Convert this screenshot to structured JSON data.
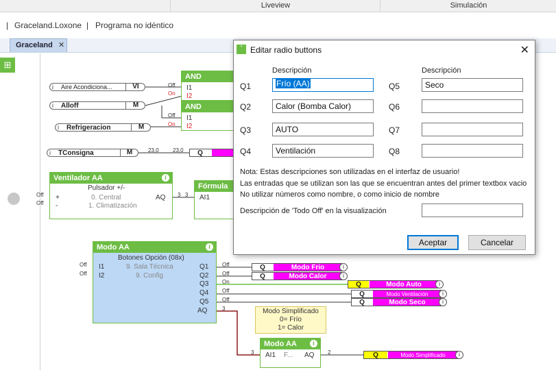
{
  "top_tabs": {
    "liveview": "Liveview",
    "simulacion": "Simulación"
  },
  "pathbar": {
    "project": "Graceland.Loxone",
    "status": "Programa no idéntico"
  },
  "doc_tab": {
    "label": "Graceland",
    "close": "✕"
  },
  "canvas": {
    "inputs": [
      {
        "name": "Aire Acondiciona...",
        "tag": "VI"
      },
      {
        "name": "Alloff",
        "tag": "M"
      },
      {
        "name": "Refrigeracion",
        "tag": "M"
      },
      {
        "name": "TConsigna",
        "tag": "M"
      }
    ],
    "and_blocks": [
      {
        "title": "AND",
        "in1": "I1",
        "in2": "I2"
      },
      {
        "title": "AND",
        "in1": "I1",
        "in2": "I2"
      }
    ],
    "signals": {
      "off": "Off",
      "on": "On",
      "val": "23,0",
      "three": "3",
      "two": "2"
    },
    "ventilador": {
      "title": "Ventilador AA",
      "subtitle": "Pulsador +/-",
      "plus": "+",
      "minus": "-",
      "opt0": "0. Central",
      "opt1": "1. Climatización",
      "out": "AQ"
    },
    "formula": {
      "title": "Fórmula",
      "in": "AI1"
    },
    "modo": {
      "title": "Modo AA",
      "subtitle": "Botones Opción (08x)",
      "in1": "I1",
      "in2": "I2",
      "in1_text": "9. Sala Técnica",
      "in2_text": "9. Config",
      "outs": [
        "Q1",
        "Q2",
        "Q3",
        "Q4",
        "Q5",
        "AQ"
      ]
    },
    "outputs": [
      {
        "q": "Q",
        "label": "Modo Frio",
        "yellow": false
      },
      {
        "q": "Q",
        "label": "Modo Calor",
        "yellow": false
      },
      {
        "q": "Q",
        "label": "Modo Auto",
        "yellow": true
      },
      {
        "q": "Q",
        "label": "Modo Ventilación",
        "yellow": false
      },
      {
        "q": "Q",
        "label": "Modo Seco",
        "yellow": false
      },
      {
        "q": "Q",
        "label": "Modo Simplificado",
        "yellow": true
      }
    ],
    "note": {
      "l1": "Modo Simplificado",
      "l2": "0= Frío",
      "l3": "1= Calor"
    },
    "modo2": {
      "title": "Modo AA",
      "in": "AI1",
      "mid": "F...",
      "out": "AQ"
    },
    "tconsigna_q": "Q"
  },
  "dialog": {
    "title": "Editar radio buttons",
    "col_header": "Descripción",
    "left": [
      {
        "label": "Q1",
        "value": "Frío (AA)"
      },
      {
        "label": "Q2",
        "value": "Calor (Bomba Calor)"
      },
      {
        "label": "Q3",
        "value": "AUTO"
      },
      {
        "label": "Q4",
        "value": "Ventilación"
      }
    ],
    "right": [
      {
        "label": "Q5",
        "value": "Seco"
      },
      {
        "label": "Q6",
        "value": ""
      },
      {
        "label": "Q7",
        "value": ""
      },
      {
        "label": "Q8",
        "value": ""
      }
    ],
    "note1": "Nota: Estas descripciones son utilizadas en el interfaz de usuario!",
    "note2": "Las entradas que se utilizan son las que se encuentran antes del primer textbox vacio",
    "note3": "No utilizar números como nombre, o como inicio de nombre",
    "todo_off_label": "Descripción de 'Todo Off' en la visualización",
    "todo_off_value": "",
    "accept": "Aceptar",
    "cancel": "Cancelar"
  }
}
